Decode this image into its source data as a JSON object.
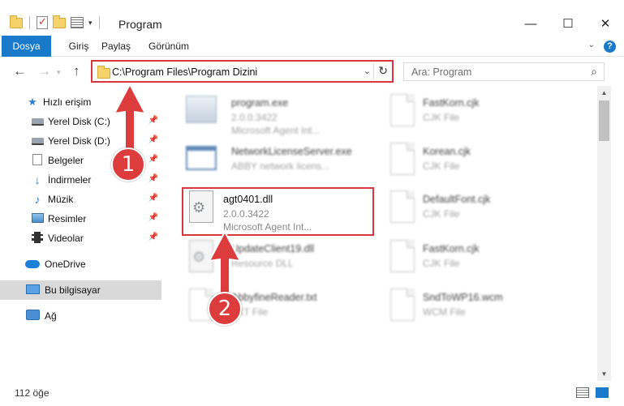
{
  "window": {
    "title": "Program",
    "minimize": "—",
    "maximize": "☐",
    "close": "✕"
  },
  "ribbon": {
    "tabs": [
      "Dosya",
      "Giriş",
      "Paylaş",
      "Görünüm"
    ],
    "help": "?"
  },
  "nav": {
    "back": "←",
    "forward": "→",
    "up": "↑",
    "address": "C:\\Program Files\\Program Dizini",
    "search_placeholder": "Ara: Program"
  },
  "sidebar": {
    "items": [
      {
        "label": "Hızlı erişim",
        "icon": "star-icon"
      },
      {
        "label": "Yerel Disk (C:)",
        "icon": "drive-icon",
        "pinned": true
      },
      {
        "label": "Yerel Disk (D:)",
        "icon": "drive-icon",
        "pinned": true
      },
      {
        "label": "Belgeler",
        "icon": "documents-icon",
        "pinned": true
      },
      {
        "label": "İndirmeler",
        "icon": "downloads-icon",
        "pinned": true
      },
      {
        "label": "Müzik",
        "icon": "music-icon",
        "pinned": true
      },
      {
        "label": "Resimler",
        "icon": "pictures-icon",
        "pinned": true
      },
      {
        "label": "Videolar",
        "icon": "videos-icon",
        "pinned": true
      },
      {
        "label": "OneDrive",
        "icon": "cloud-icon"
      },
      {
        "label": "Bu bilgisayar",
        "icon": "computer-icon",
        "selected": true
      },
      {
        "label": "Ağ",
        "icon": "network-icon"
      }
    ]
  },
  "files": {
    "left": [
      {
        "name": "program.exe",
        "meta1": "2.0.0.3422",
        "meta2": "Microsoft Agent Int...",
        "icon": "exe-icon"
      },
      {
        "name": "NetworkLicenseServer.exe",
        "meta1": "ABBY network licens...",
        "meta2": "",
        "icon": "network-exe-icon"
      },
      {
        "name": "agt0401.dll",
        "meta1": "2.0.0.3422",
        "meta2": "Microsoft Agent Int...",
        "icon": "dll-gear-icon"
      },
      {
        "name": "UpdateClient19.dll",
        "meta1": "Resource DLL",
        "meta2": "",
        "icon": "dll-gear-icon"
      },
      {
        "name": "AbbyfineReader.txt",
        "meta1": "TXT File",
        "meta2": "",
        "icon": "file-icon"
      }
    ],
    "right": [
      {
        "name": "FastKorn.cjk",
        "meta1": "CJK File"
      },
      {
        "name": "Korean.cjk",
        "meta1": "CJK File"
      },
      {
        "name": "DefaultFont.cjk",
        "meta1": "CJK File"
      },
      {
        "name": "FastKorn.cjk",
        "meta1": "CJK File"
      },
      {
        "name": "SndToWP16.wcm",
        "meta1": "WCM File"
      }
    ]
  },
  "status": {
    "count": "112 öğe"
  },
  "annotations": {
    "badge1": "1",
    "badge2": "2",
    "color": "#dd3c3c"
  }
}
